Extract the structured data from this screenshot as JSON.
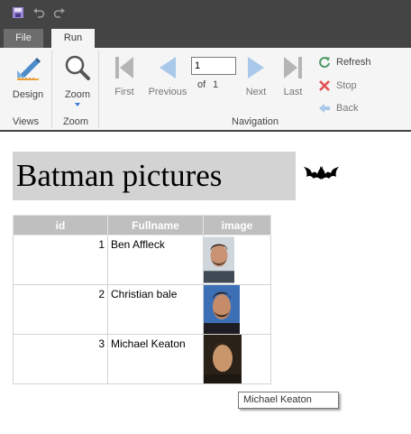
{
  "quick_access": {
    "save_icon": "save-icon",
    "undo_icon": "undo-icon",
    "redo_icon": "redo-icon"
  },
  "tabs": [
    {
      "label": "File",
      "active": false
    },
    {
      "label": "Run",
      "active": true
    }
  ],
  "ribbon": {
    "groups": {
      "views": "Views",
      "zoom": "Zoom",
      "navigation": "Navigation"
    },
    "design_label": "Design",
    "zoom_label": "Zoom",
    "first_label": "First",
    "previous_label": "Previous",
    "next_label": "Next",
    "last_label": "Last",
    "page_value": "1",
    "of_label": "of",
    "page_total": "1",
    "refresh_label": "Refresh",
    "stop_label": "Stop",
    "back_label": "Back"
  },
  "colors": {
    "titlebar": "#444444",
    "ribbon": "#f5f5f5",
    "nav_icon_disabled": "#b5b5b5",
    "nav_icon_blue": "#a9c8ea",
    "refresh_green": "#4e9a67",
    "stop_red": "#e25050",
    "table_header": "#bfbfbf",
    "title_band": "#d3d3d3"
  },
  "report": {
    "title": "Batman pictures",
    "columns": [
      "id",
      "Fullname",
      "image"
    ],
    "rows": [
      {
        "id": "1",
        "fullname": "Ben Affleck"
      },
      {
        "id": "2",
        "fullname": "Christian bale"
      },
      {
        "id": "3",
        "fullname": "Michael Keaton"
      }
    ]
  },
  "tooltip": "Michael Keaton"
}
